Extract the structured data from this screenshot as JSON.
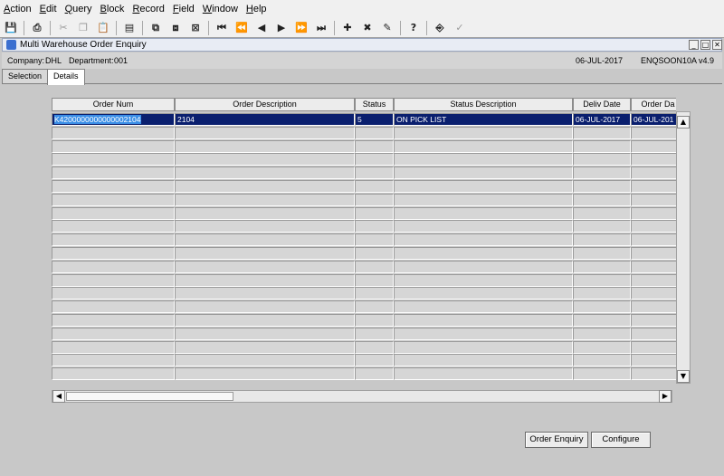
{
  "menu": [
    "Action",
    "Edit",
    "Query",
    "Block",
    "Record",
    "Field",
    "Window",
    "Help"
  ],
  "toolbar": [
    {
      "icon": "save-icon",
      "glyph": "💾",
      "dim": false
    },
    {
      "sep": true
    },
    {
      "icon": "print-icon",
      "glyph": "⎙",
      "dim": false
    },
    {
      "sep": true
    },
    {
      "icon": "cut-icon",
      "glyph": "✂",
      "dim": true
    },
    {
      "icon": "copy-icon",
      "glyph": "❐",
      "dim": true
    },
    {
      "icon": "paste-icon",
      "glyph": "📋",
      "dim": true
    },
    {
      "sep": true
    },
    {
      "icon": "list-icon",
      "glyph": "▤",
      "dim": false
    },
    {
      "sep": true
    },
    {
      "icon": "enter-query-icon",
      "glyph": "⧉",
      "dim": false
    },
    {
      "icon": "execute-query-icon",
      "glyph": "⧈",
      "dim": false
    },
    {
      "icon": "cancel-query-icon",
      "glyph": "⊠",
      "dim": false
    },
    {
      "sep": true
    },
    {
      "icon": "first-record-icon",
      "glyph": "⏮",
      "dim": false
    },
    {
      "icon": "previous-set-icon",
      "glyph": "⏪",
      "dim": false
    },
    {
      "icon": "previous-record-icon",
      "glyph": "◀",
      "dim": false
    },
    {
      "icon": "next-record-icon",
      "glyph": "▶",
      "dim": false
    },
    {
      "icon": "next-set-icon",
      "glyph": "⏩",
      "dim": false
    },
    {
      "icon": "last-record-icon",
      "glyph": "⏭",
      "dim": false
    },
    {
      "sep": true
    },
    {
      "icon": "insert-record-icon",
      "glyph": "✚",
      "dim": false
    },
    {
      "icon": "delete-record-icon",
      "glyph": "✖",
      "dim": false
    },
    {
      "icon": "clear-record-icon",
      "glyph": "✎",
      "dim": false
    },
    {
      "sep": true
    },
    {
      "icon": "help-icon",
      "glyph": "?",
      "dim": false
    },
    {
      "sep": true
    },
    {
      "icon": "exit-icon",
      "glyph": "⎆",
      "dim": false
    },
    {
      "icon": "check-icon",
      "glyph": "✓",
      "dim": true
    }
  ],
  "window": {
    "title": "Multi Warehouse Order Enquiry",
    "minimize": "_",
    "maximize": "□",
    "close": "✕"
  },
  "info": {
    "company_label": "Company:",
    "company": "DHL",
    "department_label": "Department:",
    "department": "001",
    "date": "06-JUL-2017",
    "program": "ENQSOON10A",
    "version": "v4.9"
  },
  "tabs": [
    {
      "label": "Selection",
      "active": false
    },
    {
      "label": "Details",
      "active": true
    }
  ],
  "table": {
    "columns": [
      "Order Num",
      "Order Description",
      "Status",
      "Status Description",
      "Deliv Date",
      "Order Da"
    ],
    "rows": [
      [
        "K4200000000000002104",
        "2104",
        "5",
        "ON PICK LIST",
        "06-JUL-2017",
        "06-JUL-201"
      ]
    ],
    "total_rows": 20,
    "selected_row": 0
  },
  "buttons": {
    "order_enquiry": "Order Enquiry",
    "configure": "Configure"
  },
  "scroll": {
    "up": "▲",
    "down": "▼",
    "left": "◀",
    "right": "▶"
  }
}
